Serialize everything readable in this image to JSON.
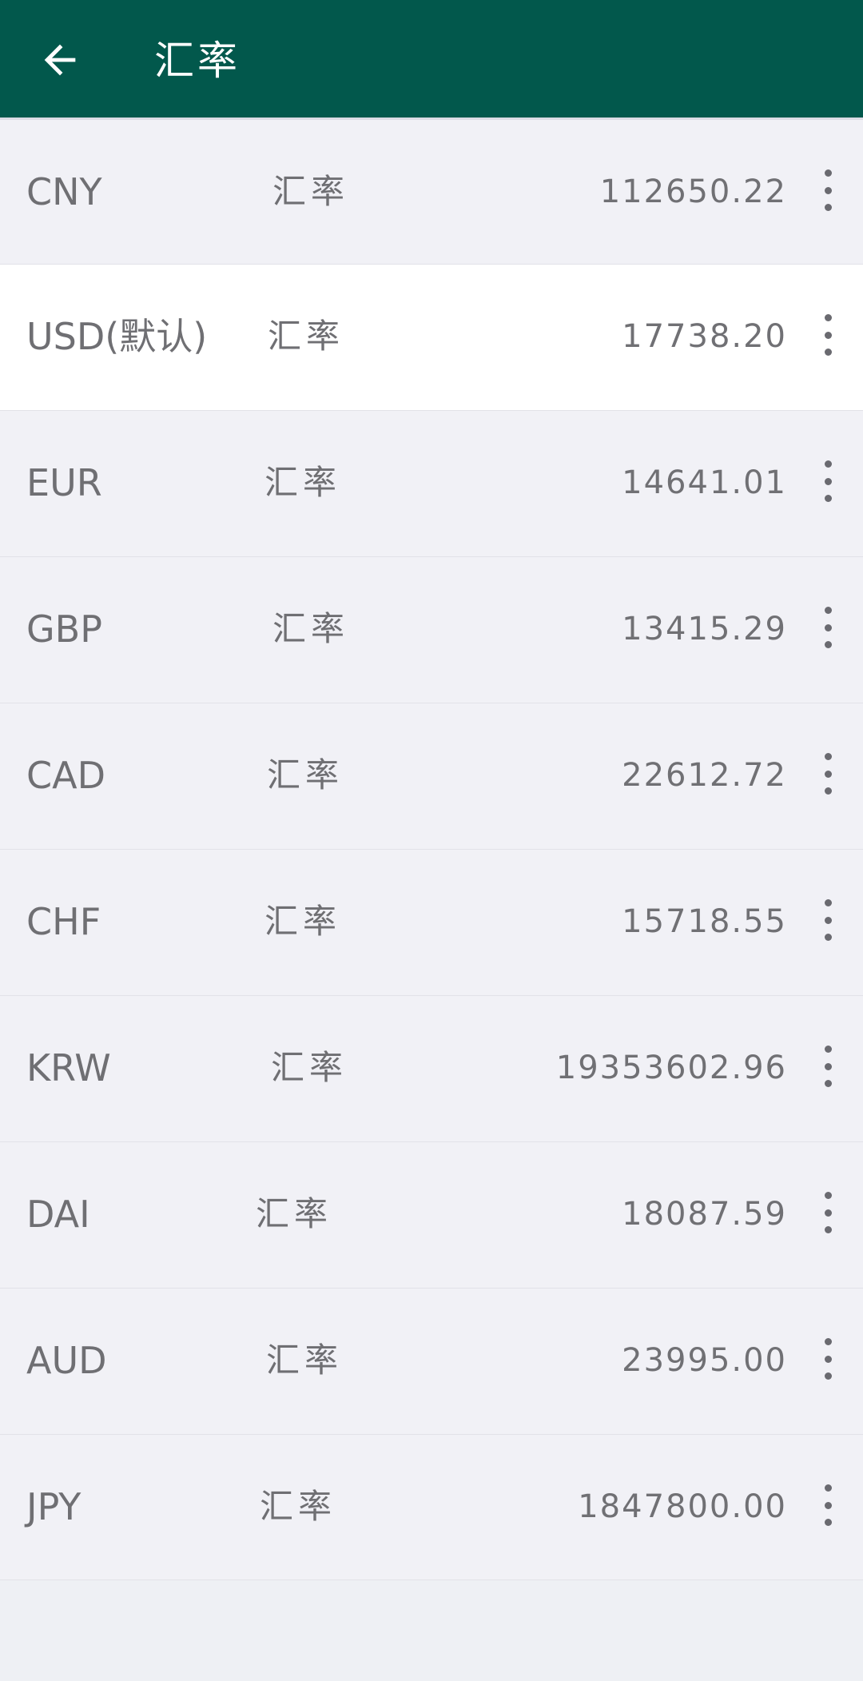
{
  "app_bar": {
    "title": "汇率",
    "back_icon": "arrow-left-icon",
    "background": "#02584c"
  },
  "rates": [
    {
      "code": "CNY",
      "label": "汇率",
      "value": "112650.22"
    },
    {
      "code": "USD(默认)",
      "label": "汇率",
      "value": "17738.20",
      "highlighted": true
    },
    {
      "code": "EUR",
      "label": "汇率",
      "value": "14641.01"
    },
    {
      "code": "GBP",
      "label": "汇率",
      "value": "13415.29"
    },
    {
      "code": "CAD",
      "label": "汇率",
      "value": "22612.72"
    },
    {
      "code": "CHF",
      "label": "汇率",
      "value": "15718.55"
    },
    {
      "code": "KRW",
      "label": "汇率",
      "value": "19353602.96"
    },
    {
      "code": "DAI",
      "label": "汇率",
      "value": "18087.59"
    },
    {
      "code": "AUD",
      "label": "汇率",
      "value": "23995.00"
    },
    {
      "code": "JPY",
      "label": "汇率",
      "value": "1847800.00"
    }
  ],
  "row_menu_icon": "more-vertical-icon"
}
